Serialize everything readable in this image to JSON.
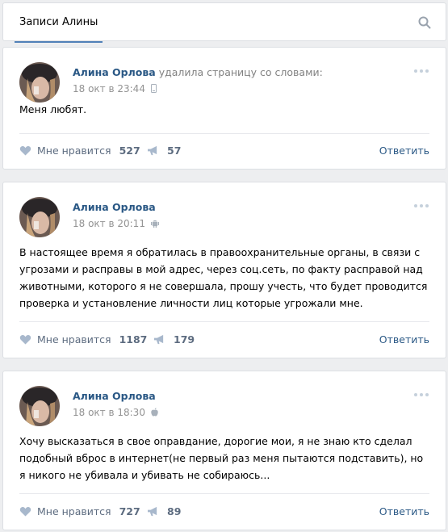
{
  "header": {
    "tab_label": "Записи Алины"
  },
  "posts": [
    {
      "author": "Алина Орлова",
      "action": "удалила страницу со словами:",
      "time": "18 окт в 23:44",
      "device_icon": "mobile-icon",
      "text": "Меня любят.",
      "like_label": "Мне нравится",
      "likes": "527",
      "shares": "57",
      "comment_label": "Ответить"
    },
    {
      "author": "Алина Орлова",
      "action": "",
      "time": "18 окт в 20:11",
      "device_icon": "android-icon",
      "text": "В настоящее время я обратилась в правоохранительные органы, в связи с угрозами и расправы в мой адрес, через соц.сеть, по факту расправой над животными, которого я не совершала, прошу учесть, что будет проводится проверка и установление личности лиц которые угрожали мне.",
      "like_label": "Мне нравится",
      "likes": "1187",
      "shares": "179",
      "comment_label": "Ответить"
    },
    {
      "author": "Алина Орлова",
      "action": "",
      "time": "18 окт в 18:30",
      "device_icon": "apple-icon",
      "text": "Хочу высказаться в свое оправдание, дорогие мои, я не знаю кто сделал подобный вброс в интернет(не первый раз меня пытаются подставить), но я никого не убивала и убивать не собираюсь...",
      "like_label": "Мне нравится",
      "likes": "727",
      "shares": "89",
      "comment_label": "Ответить"
    }
  ],
  "colors": {
    "accent": "#5181b8",
    "link": "#2a5885",
    "background": "#edeef0"
  }
}
